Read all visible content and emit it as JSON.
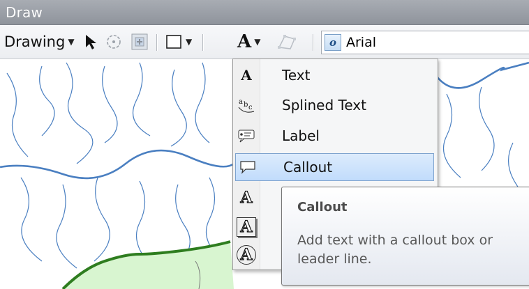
{
  "window": {
    "title": "Draw"
  },
  "toolbar": {
    "drawing_label": "Drawing",
    "font_value": "Arial",
    "icons": [
      "select-elements-icon",
      "rotate-icon",
      "zoom-to-selected-icon",
      "rectangle-icon",
      "text-icon",
      "edit-vertices-icon",
      "font-icon"
    ]
  },
  "menu": {
    "items": [
      {
        "label": "Text",
        "icon": "text-A-icon"
      },
      {
        "label": "Splined Text",
        "icon": "splined-text-icon"
      },
      {
        "label": "Label",
        "icon": "label-icon"
      },
      {
        "label": "Callout",
        "icon": "callout-icon",
        "highlighted": true
      },
      {
        "label": "",
        "icon": "banner-text-icon"
      },
      {
        "label": "",
        "icon": "box-text-icon"
      },
      {
        "label": "",
        "icon": "circle-text-icon"
      }
    ]
  },
  "tooltip": {
    "title": "Callout",
    "body": "Add text with a callout box or leader line."
  },
  "colors": {
    "highlight": "#c1dcfc",
    "river": "#4a7fc1",
    "boundary": "#2e7d1f",
    "land": "#d8f5d0"
  }
}
